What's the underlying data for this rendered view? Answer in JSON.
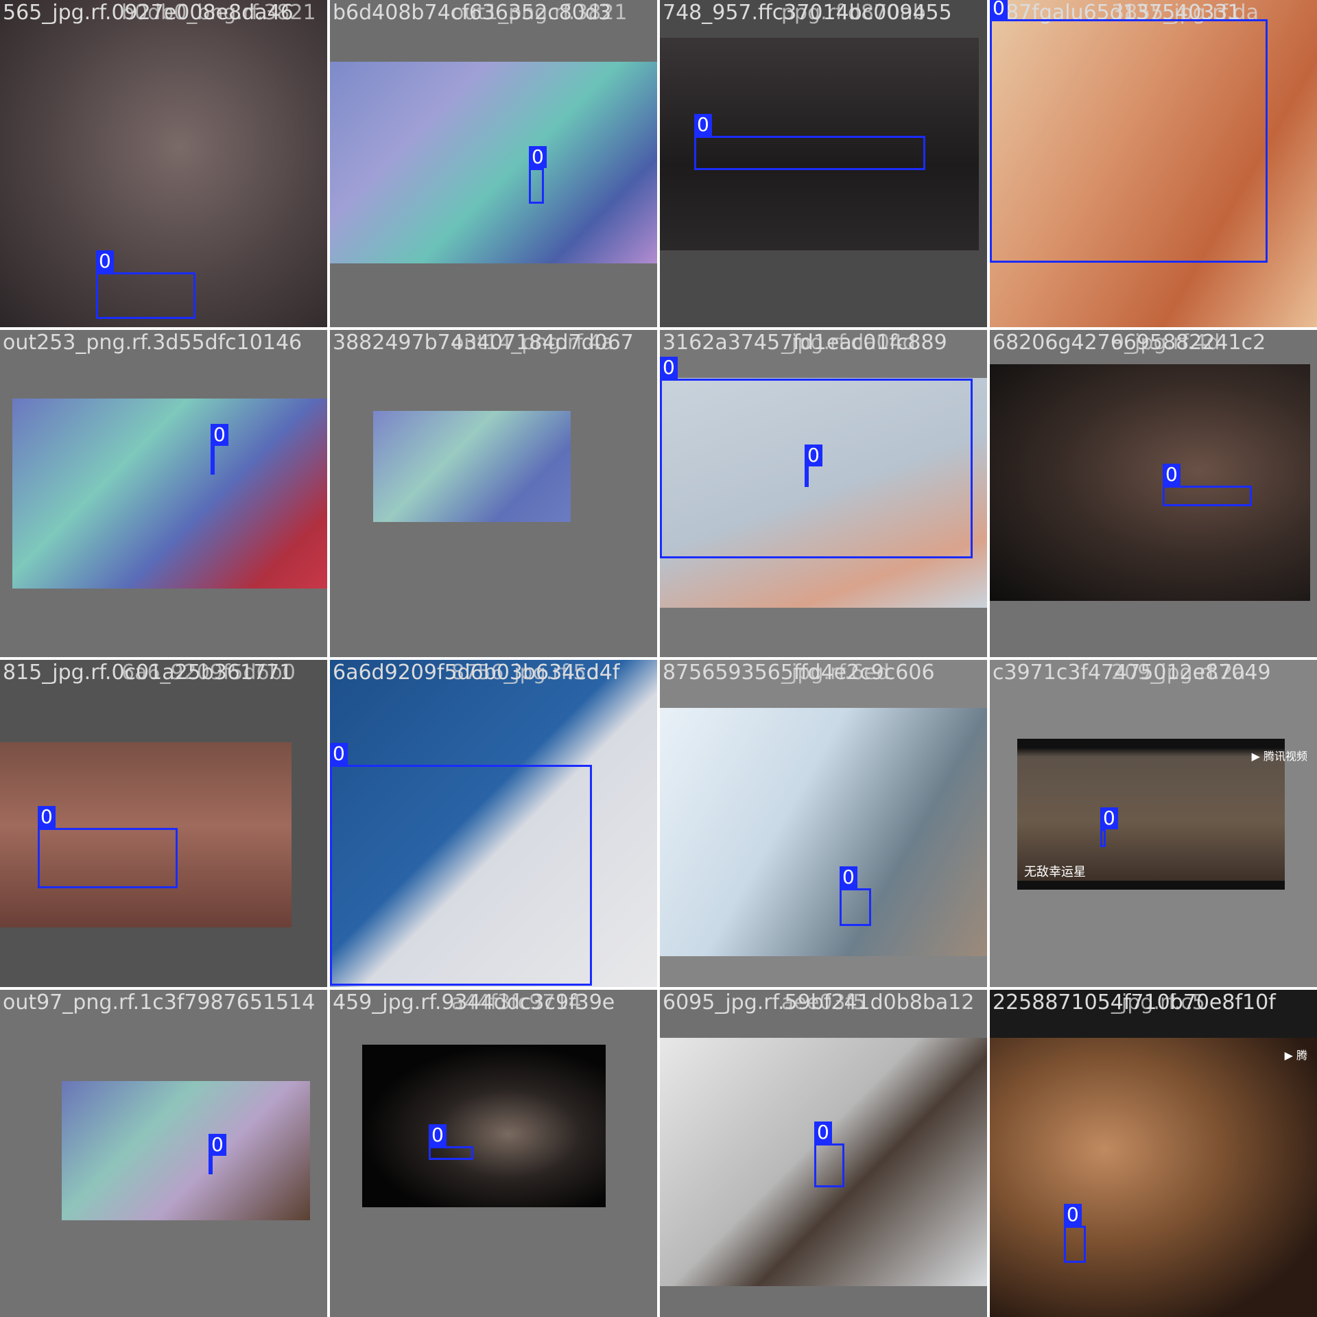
{
  "class_label": "0",
  "colors": {
    "box": "#1a2cff",
    "tile_bg": "#727272",
    "caption": "#dcdcdc"
  },
  "tiles": [
    {
      "caption": "565_jpg.rf.0927e008e8da46",
      "overlap": "b0db0_bng.rf.3821",
      "watermark": ""
    },
    {
      "caption": "b6d408b74cf636352c80d3",
      "overlap": "out1_png.rf.3821",
      "watermark": ""
    },
    {
      "caption": "748_957.ffc37014bc009455",
      "overlap": "ppg.rf.d870ab",
      "watermark": ""
    },
    {
      "caption": "387fgalu65d137540331",
      "overlap": "3855_jpg.rf.da",
      "watermark": ""
    },
    {
      "caption": "out253_png.rf.3d55dfc10146",
      "overlap": "",
      "watermark": ""
    },
    {
      "caption": "3882497b743407184d7d067",
      "overlap": "out14_png.rf.4a",
      "watermark": ""
    },
    {
      "caption": "3162a37457fd1eac01fc889",
      "overlap": "_jpg.rf.da04d",
      "watermark": ""
    },
    {
      "caption": "68206g4276695882241c2",
      "overlap": "9_jpg.rf.4d",
      "watermark": ""
    },
    {
      "caption": "815_jpg.rf.0c01a25b361771",
      "overlap": "6a6_9209f5d6b0",
      "watermark": ""
    },
    {
      "caption": "6a6d9209f5d6b03b634cd4f",
      "overlap": "8756_jpg.rf.5c",
      "watermark": ""
    },
    {
      "caption": "8756593565ffd4e2c9c606",
      "overlap": "_jpg.rf.6ed",
      "watermark": ""
    },
    {
      "caption": "c3971c3f47475012e87049",
      "overlap": "209_jpg.rf.2a",
      "watermark": "腾讯视频"
    },
    {
      "caption": "out97_png.rf.1c3f7987651514",
      "overlap": "",
      "watermark": ""
    },
    {
      "caption": "459_jpg.rf.9344ddc3c9f39e",
      "overlap": "a44f3fc9714",
      "watermark": ""
    },
    {
      "caption": "6095_jpg.rf.59bf241d0b8ba12",
      "overlap": "aee03f5",
      "watermark": ""
    },
    {
      "caption": "2258871054f710b70e8f10f",
      "overlap": "_jpg.rf.c5",
      "watermark": "腾"
    }
  ],
  "detections": [
    {
      "tile": 0,
      "label": "0"
    },
    {
      "tile": 1,
      "label": "0"
    },
    {
      "tile": 2,
      "label": "0"
    },
    {
      "tile": 3,
      "label": "0"
    },
    {
      "tile": 4,
      "label": "0"
    },
    {
      "tile": 5,
      "label": "0"
    },
    {
      "tile": 6,
      "label": "0"
    },
    {
      "tile": 7,
      "label": "0"
    },
    {
      "tile": 8,
      "label": "0"
    },
    {
      "tile": 9,
      "label": "0"
    },
    {
      "tile": 10,
      "label": "0"
    },
    {
      "tile": 11,
      "label": "0"
    },
    {
      "tile": 12,
      "label": "0"
    },
    {
      "tile": 13,
      "label": "0"
    },
    {
      "tile": 14,
      "label": "0"
    },
    {
      "tile": 15,
      "label": "0"
    }
  ],
  "subtitle_text": "无敌幸运星"
}
